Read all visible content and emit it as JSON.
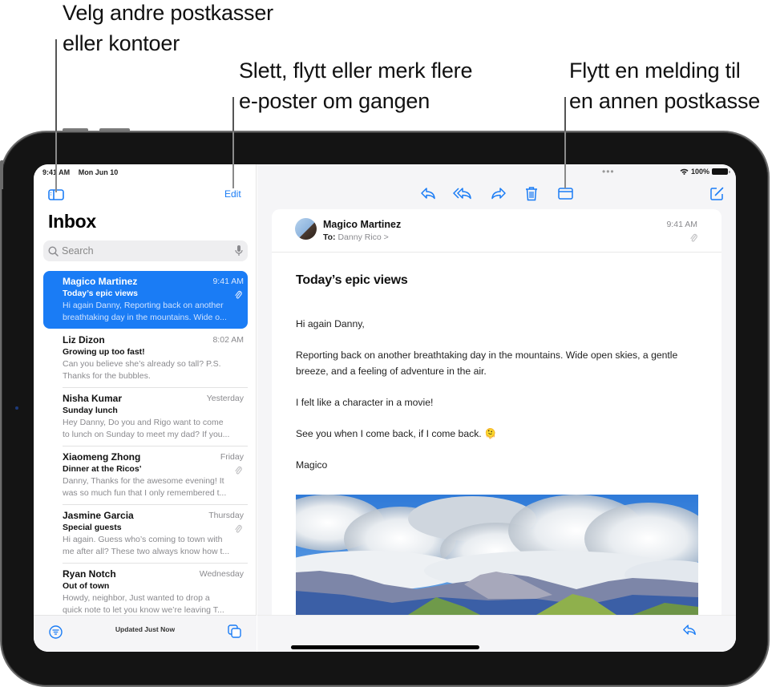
{
  "callouts": [
    {
      "lines": [
        "Velg andre postkasser",
        "eller kontoer"
      ]
    },
    {
      "lines": [
        "Slett, flytt eller merk flere",
        "e-poster om gangen"
      ]
    },
    {
      "lines": [
        "Flytt en melding til",
        "en annen postkasse"
      ]
    }
  ],
  "status_bar": {
    "time": "9:41 AM",
    "date": "Mon Jun 10",
    "battery": "100%",
    "multitask_dots": "•••"
  },
  "sidebar": {
    "edit_label": "Edit",
    "title": "Inbox",
    "search_placeholder": "Search",
    "footer_status": "Updated Just Now",
    "icons": {
      "toggle": "sidebar-toggle-icon",
      "filter": "filter-icon",
      "mailboxes": "mailboxes-stack-icon",
      "search": "search-icon",
      "mic": "microphone-icon"
    }
  },
  "messages": [
    {
      "sender": "Magico Martinez",
      "time": "9:41 AM",
      "subject": "Today’s epic views",
      "preview1": "Hi again Danny, Reporting back on another",
      "preview2": "breathtaking day in the mountains. Wide o...",
      "attachment": true,
      "selected": true
    },
    {
      "sender": "Liz Dizon",
      "time": "8:02 AM",
      "subject": "Growing up too fast!",
      "preview1": "Can you believe she’s already so tall? P.S.",
      "preview2": "Thanks for the bubbles.",
      "attachment": false,
      "selected": false
    },
    {
      "sender": "Nisha Kumar",
      "time": "Yesterday",
      "subject": "Sunday lunch",
      "preview1": "Hey Danny, Do you and Rigo want to come",
      "preview2": "to lunch on Sunday to meet my dad? If you...",
      "attachment": false,
      "selected": false
    },
    {
      "sender": "Xiaomeng Zhong",
      "time": "Friday",
      "subject": "Dinner at the Ricos’",
      "preview1": "Danny, Thanks for the awesome evening! It",
      "preview2": "was so much fun that I only remembered t...",
      "attachment": true,
      "selected": false
    },
    {
      "sender": "Jasmine Garcia",
      "time": "Thursday",
      "subject": "Special guests",
      "preview1": "Hi again. Guess who’s coming to town with",
      "preview2": "me after all? These two always know how t...",
      "attachment": true,
      "selected": false
    },
    {
      "sender": "Ryan Notch",
      "time": "Wednesday",
      "subject": "Out of town",
      "preview1": "Howdy, neighbor, Just wanted to drop a",
      "preview2": "quick note to let you know we’re leaving T...",
      "attachment": false,
      "selected": false
    }
  ],
  "toolbar": {
    "actions": [
      "reply-icon",
      "reply-all-icon",
      "forward-icon",
      "trash-icon",
      "move-to-folder-icon"
    ],
    "right_actions": [
      "compose-icon",
      "more-icon"
    ]
  },
  "message": {
    "from": "Magico Martinez",
    "to_label": "To:",
    "to": "Danny Rico",
    "to_chevron": ">",
    "time": "9:41 AM",
    "subject": "Today’s epic views",
    "body": [
      "Hi again Danny,",
      "Reporting back on another breathtaking day in the mountains. Wide open skies, a gentle breeze, and a feeling of adventure in the air.",
      "I felt like a character in a movie!",
      "See you when I come back, if I come back. 🫠",
      "Magico"
    ],
    "image": "mountain-landscape-photo"
  },
  "colors": {
    "accent": "#1a7cf5",
    "selected_row": "#1a7cf5",
    "secondary_text": "#8a8a8e",
    "bezel": "#141414"
  }
}
